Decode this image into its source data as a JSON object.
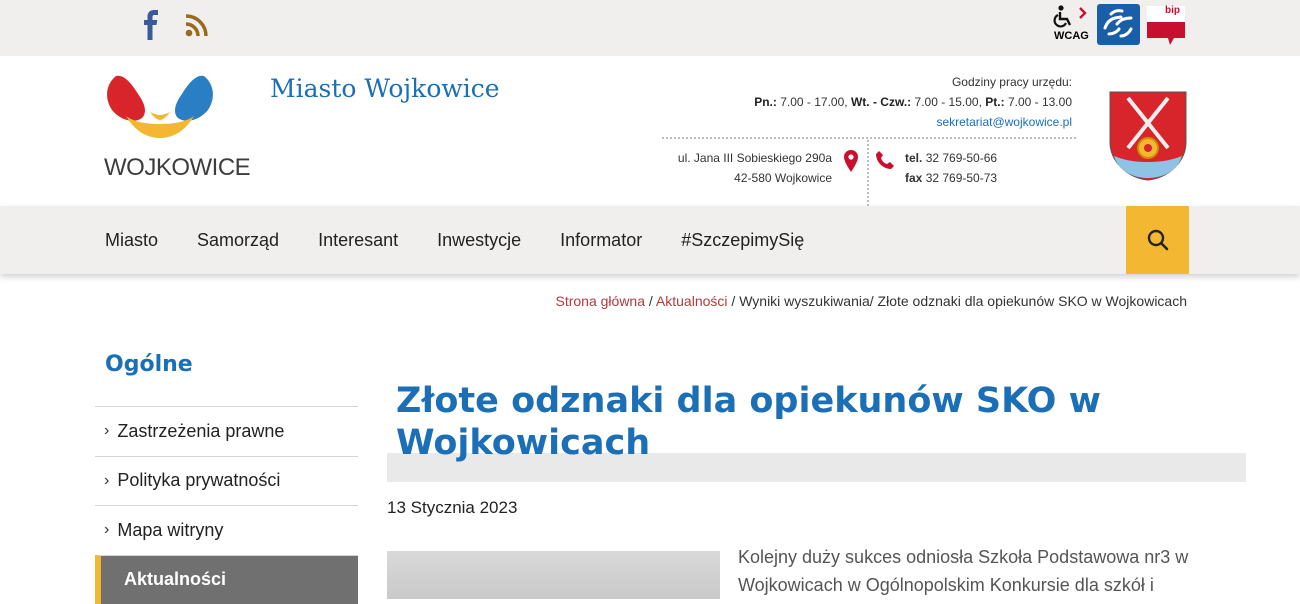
{
  "topbar": {
    "social": [
      {
        "icon": "facebook-icon"
      },
      {
        "icon": "rss-icon"
      }
    ],
    "wcag_label": "WCAG",
    "bip_label": "bip"
  },
  "header": {
    "logo_text": "WOJKOWICE",
    "site_title": "Miasto Wojkowice",
    "hours_title": "Godziny pracy urzędu:",
    "hours": [
      {
        "day": "Pn.:",
        "time": "7.00 - 17.00,"
      },
      {
        "day": "Wt. - Czw.:",
        "time": "7.00 - 15.00,"
      },
      {
        "day": "Pt.:",
        "time": "7.00 - 13.00"
      }
    ],
    "email": "sekretariat@wojkowice.pl",
    "address_line1": "ul. Jana III Sobieskiego 290a",
    "address_line2": "42-580 Wojkowice",
    "tel_label": "tel.",
    "tel": "32 769-50-66",
    "fax_label": "fax",
    "fax": "32 769-50-73"
  },
  "nav": {
    "items": [
      "Miasto",
      "Samorząd",
      "Interesant",
      "Inwestycje",
      "Informator",
      "#SzczepimySię"
    ]
  },
  "breadcrumb": {
    "home": "Strona główna",
    "news": "Aktualności",
    "search": "Wyniki wyszukiwania",
    "current": "Złote odznaki dla opiekunów SKO w Wojkowicach",
    "sep": "/"
  },
  "sidebar": {
    "title": "Ogólne",
    "items": [
      {
        "label": "Zastrzeżenia prawne"
      },
      {
        "label": "Polityka prywatności"
      },
      {
        "label": "Mapa witryny"
      },
      {
        "label": "Aktualności"
      }
    ]
  },
  "article": {
    "title": "Złote odznaki dla opiekunów SKO w Wojkowicach",
    "date": "13 Stycznia 2023",
    "lead": "Kolejny duży sukces odniosła Szkoła Podstawowa nr3 w Wojkowicach w Ogólnopolskim Konkursie dla szkół i"
  },
  "colors": {
    "accent_blue": "#1b6fb6",
    "accent_yellow": "#f4b731",
    "breadcrumb_link": "#b33a3a"
  }
}
